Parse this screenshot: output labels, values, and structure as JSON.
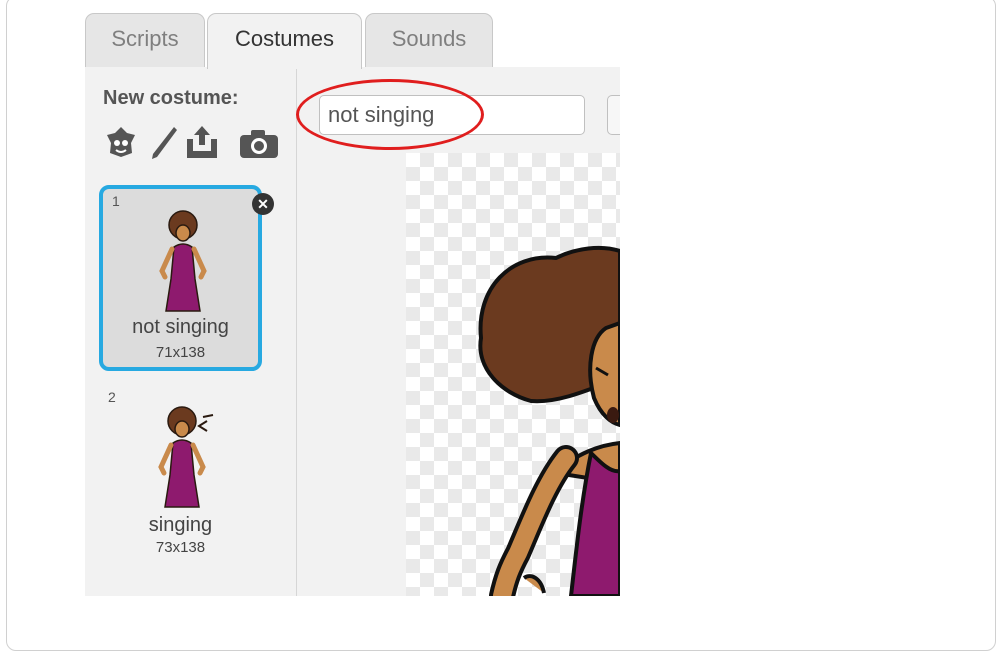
{
  "tabs": [
    {
      "label": "Scripts",
      "active": false
    },
    {
      "label": "Costumes",
      "active": true
    },
    {
      "label": "Sounds",
      "active": false
    }
  ],
  "costume_pane": {
    "heading": "New costume:",
    "tools": [
      "choose-costume-from-library-icon",
      "paint-new-costume-icon",
      "upload-costume-icon",
      "camera-icon"
    ],
    "costumes": [
      {
        "number": "1",
        "name": "not singing",
        "size": "71x138",
        "selected": true
      },
      {
        "number": "2",
        "name": "singing",
        "size": "73x138",
        "selected": false
      }
    ]
  },
  "editor": {
    "costume_name_value": "not singing"
  },
  "colors": {
    "selection_border": "#27a9e1",
    "highlight": "#e01e1e",
    "dress": "#8e1a6e",
    "hair": "#6b3a1f",
    "skin": "#c98a4b"
  }
}
